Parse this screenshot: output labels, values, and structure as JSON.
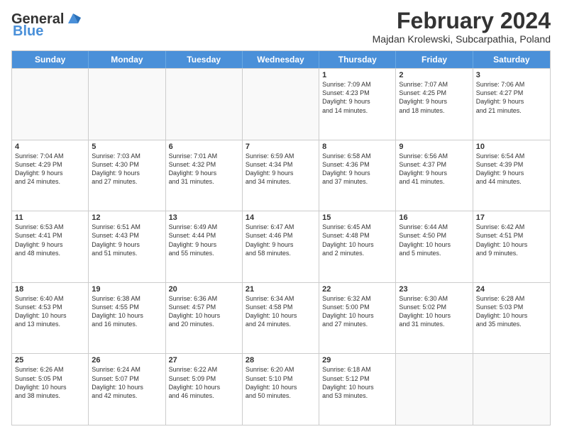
{
  "logo": {
    "general": "General",
    "blue": "Blue"
  },
  "header": {
    "month": "February 2024",
    "location": "Majdan Krolewski, Subcarpathia, Poland"
  },
  "days_of_week": [
    "Sunday",
    "Monday",
    "Tuesday",
    "Wednesday",
    "Thursday",
    "Friday",
    "Saturday"
  ],
  "weeks": [
    [
      {
        "day": "",
        "info": "",
        "empty": true
      },
      {
        "day": "",
        "info": "",
        "empty": true
      },
      {
        "day": "",
        "info": "",
        "empty": true
      },
      {
        "day": "",
        "info": "",
        "empty": true
      },
      {
        "day": "1",
        "info": "Sunrise: 7:09 AM\nSunset: 4:23 PM\nDaylight: 9 hours\nand 14 minutes."
      },
      {
        "day": "2",
        "info": "Sunrise: 7:07 AM\nSunset: 4:25 PM\nDaylight: 9 hours\nand 18 minutes."
      },
      {
        "day": "3",
        "info": "Sunrise: 7:06 AM\nSunset: 4:27 PM\nDaylight: 9 hours\nand 21 minutes."
      }
    ],
    [
      {
        "day": "4",
        "info": "Sunrise: 7:04 AM\nSunset: 4:29 PM\nDaylight: 9 hours\nand 24 minutes."
      },
      {
        "day": "5",
        "info": "Sunrise: 7:03 AM\nSunset: 4:30 PM\nDaylight: 9 hours\nand 27 minutes."
      },
      {
        "day": "6",
        "info": "Sunrise: 7:01 AM\nSunset: 4:32 PM\nDaylight: 9 hours\nand 31 minutes."
      },
      {
        "day": "7",
        "info": "Sunrise: 6:59 AM\nSunset: 4:34 PM\nDaylight: 9 hours\nand 34 minutes."
      },
      {
        "day": "8",
        "info": "Sunrise: 6:58 AM\nSunset: 4:36 PM\nDaylight: 9 hours\nand 37 minutes."
      },
      {
        "day": "9",
        "info": "Sunrise: 6:56 AM\nSunset: 4:37 PM\nDaylight: 9 hours\nand 41 minutes."
      },
      {
        "day": "10",
        "info": "Sunrise: 6:54 AM\nSunset: 4:39 PM\nDaylight: 9 hours\nand 44 minutes."
      }
    ],
    [
      {
        "day": "11",
        "info": "Sunrise: 6:53 AM\nSunset: 4:41 PM\nDaylight: 9 hours\nand 48 minutes."
      },
      {
        "day": "12",
        "info": "Sunrise: 6:51 AM\nSunset: 4:43 PM\nDaylight: 9 hours\nand 51 minutes."
      },
      {
        "day": "13",
        "info": "Sunrise: 6:49 AM\nSunset: 4:44 PM\nDaylight: 9 hours\nand 55 minutes."
      },
      {
        "day": "14",
        "info": "Sunrise: 6:47 AM\nSunset: 4:46 PM\nDaylight: 9 hours\nand 58 minutes."
      },
      {
        "day": "15",
        "info": "Sunrise: 6:45 AM\nSunset: 4:48 PM\nDaylight: 10 hours\nand 2 minutes."
      },
      {
        "day": "16",
        "info": "Sunrise: 6:44 AM\nSunset: 4:50 PM\nDaylight: 10 hours\nand 5 minutes."
      },
      {
        "day": "17",
        "info": "Sunrise: 6:42 AM\nSunset: 4:51 PM\nDaylight: 10 hours\nand 9 minutes."
      }
    ],
    [
      {
        "day": "18",
        "info": "Sunrise: 6:40 AM\nSunset: 4:53 PM\nDaylight: 10 hours\nand 13 minutes."
      },
      {
        "day": "19",
        "info": "Sunrise: 6:38 AM\nSunset: 4:55 PM\nDaylight: 10 hours\nand 16 minutes."
      },
      {
        "day": "20",
        "info": "Sunrise: 6:36 AM\nSunset: 4:57 PM\nDaylight: 10 hours\nand 20 minutes."
      },
      {
        "day": "21",
        "info": "Sunrise: 6:34 AM\nSunset: 4:58 PM\nDaylight: 10 hours\nand 24 minutes."
      },
      {
        "day": "22",
        "info": "Sunrise: 6:32 AM\nSunset: 5:00 PM\nDaylight: 10 hours\nand 27 minutes."
      },
      {
        "day": "23",
        "info": "Sunrise: 6:30 AM\nSunset: 5:02 PM\nDaylight: 10 hours\nand 31 minutes."
      },
      {
        "day": "24",
        "info": "Sunrise: 6:28 AM\nSunset: 5:03 PM\nDaylight: 10 hours\nand 35 minutes."
      }
    ],
    [
      {
        "day": "25",
        "info": "Sunrise: 6:26 AM\nSunset: 5:05 PM\nDaylight: 10 hours\nand 38 minutes."
      },
      {
        "day": "26",
        "info": "Sunrise: 6:24 AM\nSunset: 5:07 PM\nDaylight: 10 hours\nand 42 minutes."
      },
      {
        "day": "27",
        "info": "Sunrise: 6:22 AM\nSunset: 5:09 PM\nDaylight: 10 hours\nand 46 minutes."
      },
      {
        "day": "28",
        "info": "Sunrise: 6:20 AM\nSunset: 5:10 PM\nDaylight: 10 hours\nand 50 minutes."
      },
      {
        "day": "29",
        "info": "Sunrise: 6:18 AM\nSunset: 5:12 PM\nDaylight: 10 hours\nand 53 minutes."
      },
      {
        "day": "",
        "info": "",
        "empty": true
      },
      {
        "day": "",
        "info": "",
        "empty": true
      }
    ]
  ]
}
